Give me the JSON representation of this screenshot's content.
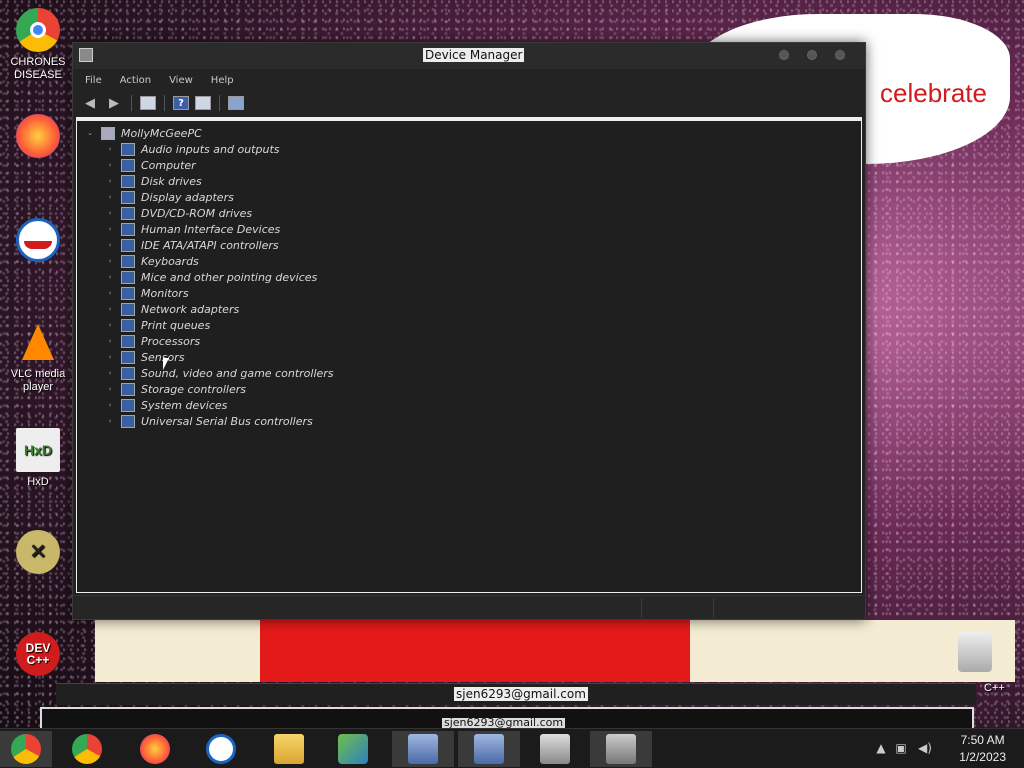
{
  "desktop": {
    "icons": [
      {
        "label": "CHRONES DISEASE",
        "color": "#34a853",
        "glyph": "●"
      },
      {
        "label": "",
        "color": "#ff7139",
        "glyph": "◉"
      },
      {
        "label": "",
        "color": "#1a64c2",
        "glyph": "◐"
      },
      {
        "label": "VLC media player",
        "color": "#ff8800",
        "glyph": "▲"
      },
      {
        "label": "HxD",
        "color": "#e6e6e6",
        "glyph": "HxD"
      },
      {
        "label": "",
        "color": "#444444",
        "glyph": "✕"
      },
      {
        "label": "",
        "color": "#d01c1c",
        "glyph": "DEV"
      }
    ],
    "right_label": "C++"
  },
  "window": {
    "title": "Device Manager",
    "menu": [
      "File",
      "Action",
      "View",
      "Help"
    ],
    "toolbar": {
      "back": "back-icon",
      "forward": "forward-icon",
      "properties": "properties-icon",
      "help": "help-icon",
      "view": "view-icon",
      "scan": "scan-hardware-icon"
    },
    "tree": {
      "root": "MollyMcGeePC",
      "items": [
        "Audio inputs and outputs",
        "Computer",
        "Disk drives",
        "Display adapters",
        "DVD/CD-ROM drives",
        "Human Interface Devices",
        "IDE ATA/ATAPI controllers",
        "Keyboards",
        "Mice and other pointing devices",
        "Monitors",
        "Network adapters",
        "Print queues",
        "Processors",
        "Sensors",
        "Sound, video and game controllers",
        "Storage controllers",
        "System devices",
        "Universal Serial Bus controllers"
      ]
    }
  },
  "popups": {
    "email1": "sjen6293@gmail.com",
    "email2": "sjen6293@gmail.com"
  },
  "taskbar": {
    "apps": [
      "chrome-icon",
      "chrome-icon",
      "firefox-icon",
      "obama-icon",
      "file-explorer-icon",
      "network-icon",
      "device-manager-icon",
      "device-manager-icon",
      "printer-icon",
      "control-panel-icon"
    ],
    "time": "7:50 AM",
    "date": "1/2/2023"
  },
  "colors": {
    "window_bg": "#232323",
    "taskbar_bg": "#1b1b1b",
    "banner_red": "#d01c1c"
  }
}
